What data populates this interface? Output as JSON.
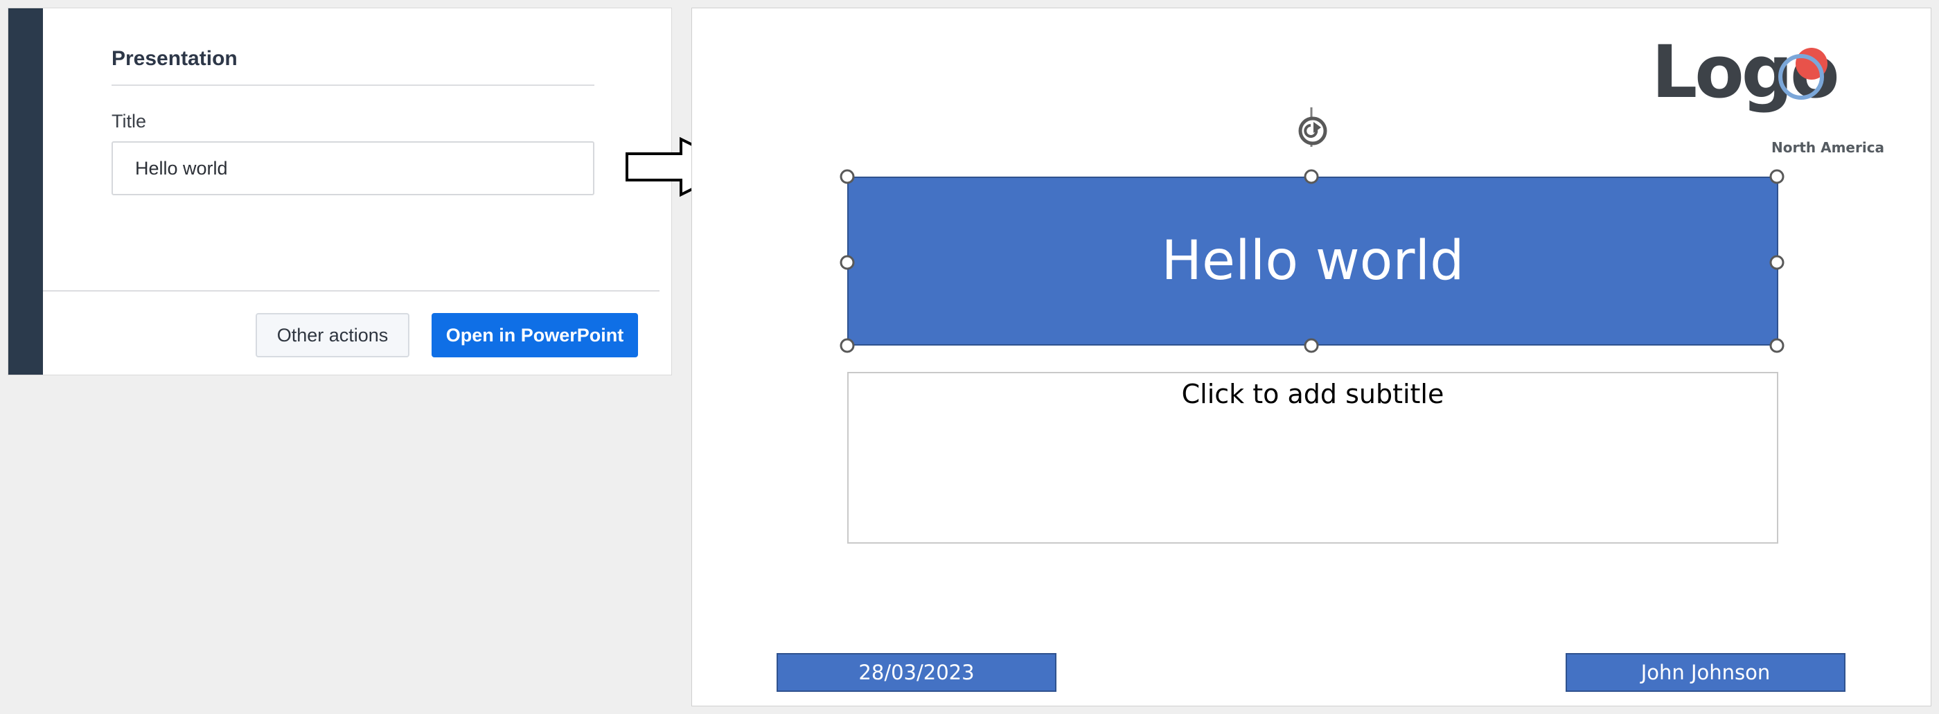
{
  "form": {
    "heading": "Presentation",
    "title_label": "Title",
    "title_value": "Hello world",
    "other_actions_label": "Other actions",
    "open_label": "Open in PowerPoint"
  },
  "slide": {
    "title": "Hello world",
    "subtitle_placeholder": "Click to add subtitle",
    "date": "28/03/2023",
    "author": "John Johnson",
    "logo": {
      "word": "Logo",
      "region": "North America"
    }
  },
  "colors": {
    "sidebar": "#2b3a4c",
    "primary_button": "#0f6fe6",
    "slide_accent": "#4472c4",
    "logo_red": "#e8524a",
    "logo_blue": "#7ba7d9"
  },
  "icons": {
    "arrow": "right-arrow-icon",
    "rotate": "rotate-handle-icon"
  }
}
